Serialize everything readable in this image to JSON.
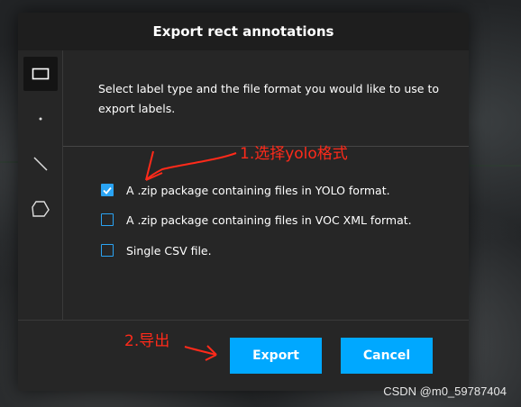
{
  "dialog": {
    "title": "Export rect annotations",
    "description": "Select label type and the file format you would like to use to export labels.",
    "options": [
      {
        "label": "A .zip package containing files in YOLO format.",
        "checked": true
      },
      {
        "label": "A .zip package containing files in VOC XML format.",
        "checked": false
      },
      {
        "label": "Single CSV file.",
        "checked": false
      }
    ],
    "buttons": {
      "export": "Export",
      "cancel": "Cancel"
    }
  },
  "tools": [
    "rectangle-tool-icon",
    "point-tool-icon",
    "line-tool-icon",
    "polygon-tool-icon"
  ],
  "annotations": {
    "step1": "1.选择yolo格式",
    "step2": "2.导出"
  },
  "watermark": "CSDN @m0_59787404",
  "colors": {
    "accent": "#00a8ff",
    "annotation": "#ff2a1a",
    "dialog_bg": "#262626",
    "title_bg": "#1e1e1e"
  }
}
